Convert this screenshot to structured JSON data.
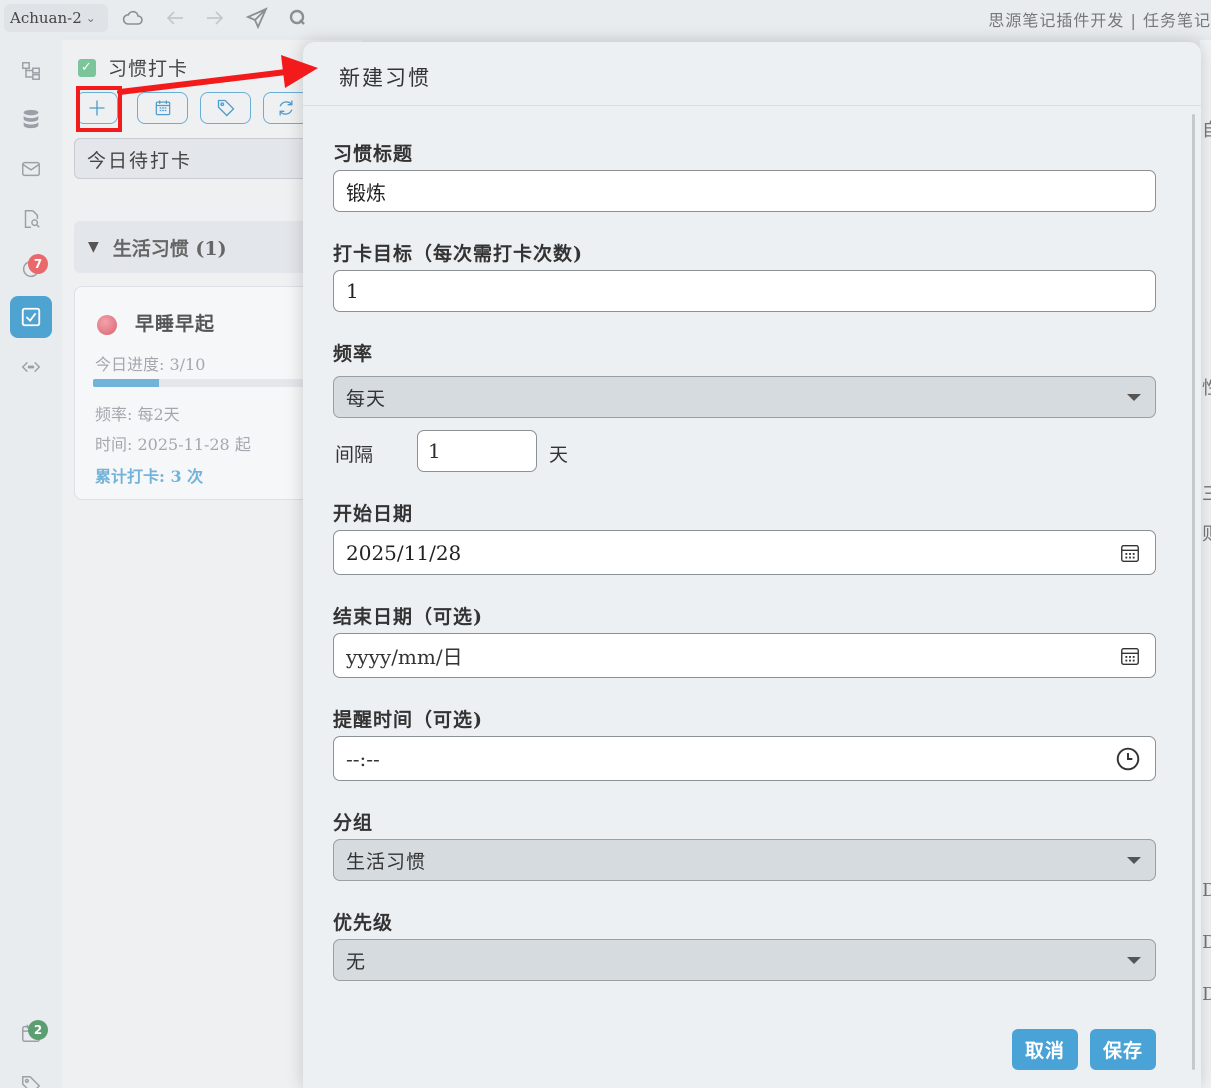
{
  "topbar": {
    "workspace": "Achuan-2",
    "title": "思源笔记插件开发 | 任务笔记"
  },
  "dock": {
    "badges": {
      "sync": "7",
      "bottom": "2"
    },
    "colors": {
      "active": "#4fa3d1",
      "badge_red": "#e8686b",
      "badge_green": "#5a9e72"
    }
  },
  "panel": {
    "title": "习惯打卡",
    "filter": "今日待打卡",
    "group": {
      "label": "生活习惯 (1)"
    },
    "habit": {
      "name": "早睡早起",
      "progress_text": "今日进度: 3/10",
      "progress": 0.3,
      "frequency_text": "频率: 每2天",
      "time_text": "时间: 2025-11-28 起",
      "total_text": "累计打卡: 3 次"
    }
  },
  "dialog": {
    "title": "新建习惯",
    "fields": {
      "title_label": "习惯标题",
      "title_value": "锻炼",
      "target_label": "打卡目标（每次需打卡次数)",
      "target_value": "1",
      "freq_label": "频率",
      "freq_value": "每天",
      "interval_label": "间隔",
      "interval_value": "1",
      "interval_unit": "天",
      "start_label": "开始日期",
      "start_value": "2025/11/28",
      "end_label": "结束日期（可选)",
      "end_value": "yyyy/mm/日",
      "reminder_label": "提醒时间（可选)",
      "reminder_value": "--:--",
      "group_label": "分组",
      "group_value": "生活习惯",
      "priority_label": "优先级",
      "priority_value": "无"
    },
    "buttons": {
      "cancel": "取消",
      "save": "保存"
    }
  },
  "behind": {
    "chars": [
      "自",
      "性",
      "三",
      "则",
      "D",
      "D",
      "D"
    ]
  },
  "colors": {
    "accent": "#4aa3d6",
    "annotation_red": "#f21a1a"
  }
}
